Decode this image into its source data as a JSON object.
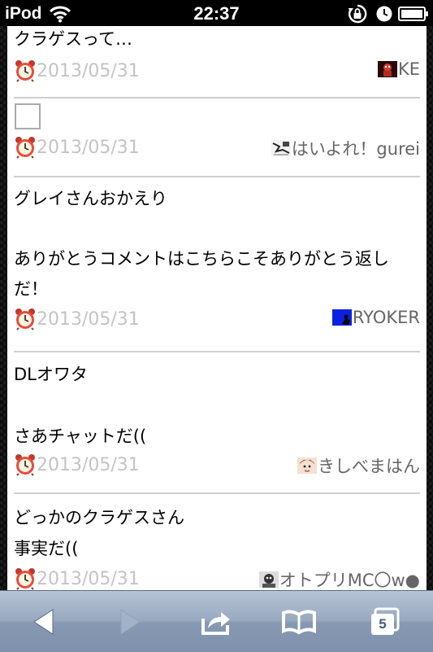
{
  "status_bar": {
    "carrier": "iPod",
    "time": "22:37"
  },
  "comments": [
    {
      "text": "クラゲスって…",
      "date": "2013/05/31",
      "author": "KE",
      "avatar": "red-robot"
    },
    {
      "text": "",
      "has_checkbox": true,
      "date": "2013/05/31",
      "author": "はいよれ！gurei",
      "avatar": "sketch"
    },
    {
      "text": "グレイさんおかえり\n\nありがとうコメントはこちらこそありがとう返しだ！",
      "date": "2013/05/31",
      "author": "RYOKER",
      "avatar": "blue-square"
    },
    {
      "text": "DLオワタ\n\nさあチャットだ((",
      "date": "2013/05/31",
      "author": "きしべまはん",
      "avatar": "anime-face"
    },
    {
      "text": "どっかのクラゲスさん\n事実だ((",
      "date": "2013/05/31",
      "author": "オトプリMC〇w●",
      "avatar": "monochrome-face"
    }
  ],
  "toolbar": {
    "back_icon": "back-arrow-icon",
    "forward_icon": "forward-arrow-icon",
    "share_icon": "share-icon",
    "bookmarks_icon": "bookmarks-book-icon",
    "tabs_count": "5"
  },
  "colors": {
    "date_text": "#c4c4c4",
    "author_text": "#666666",
    "divider": "#cfcfcf",
    "toolbar_top": "#b7c4d7",
    "toolbar_bottom": "#7e90ab"
  }
}
